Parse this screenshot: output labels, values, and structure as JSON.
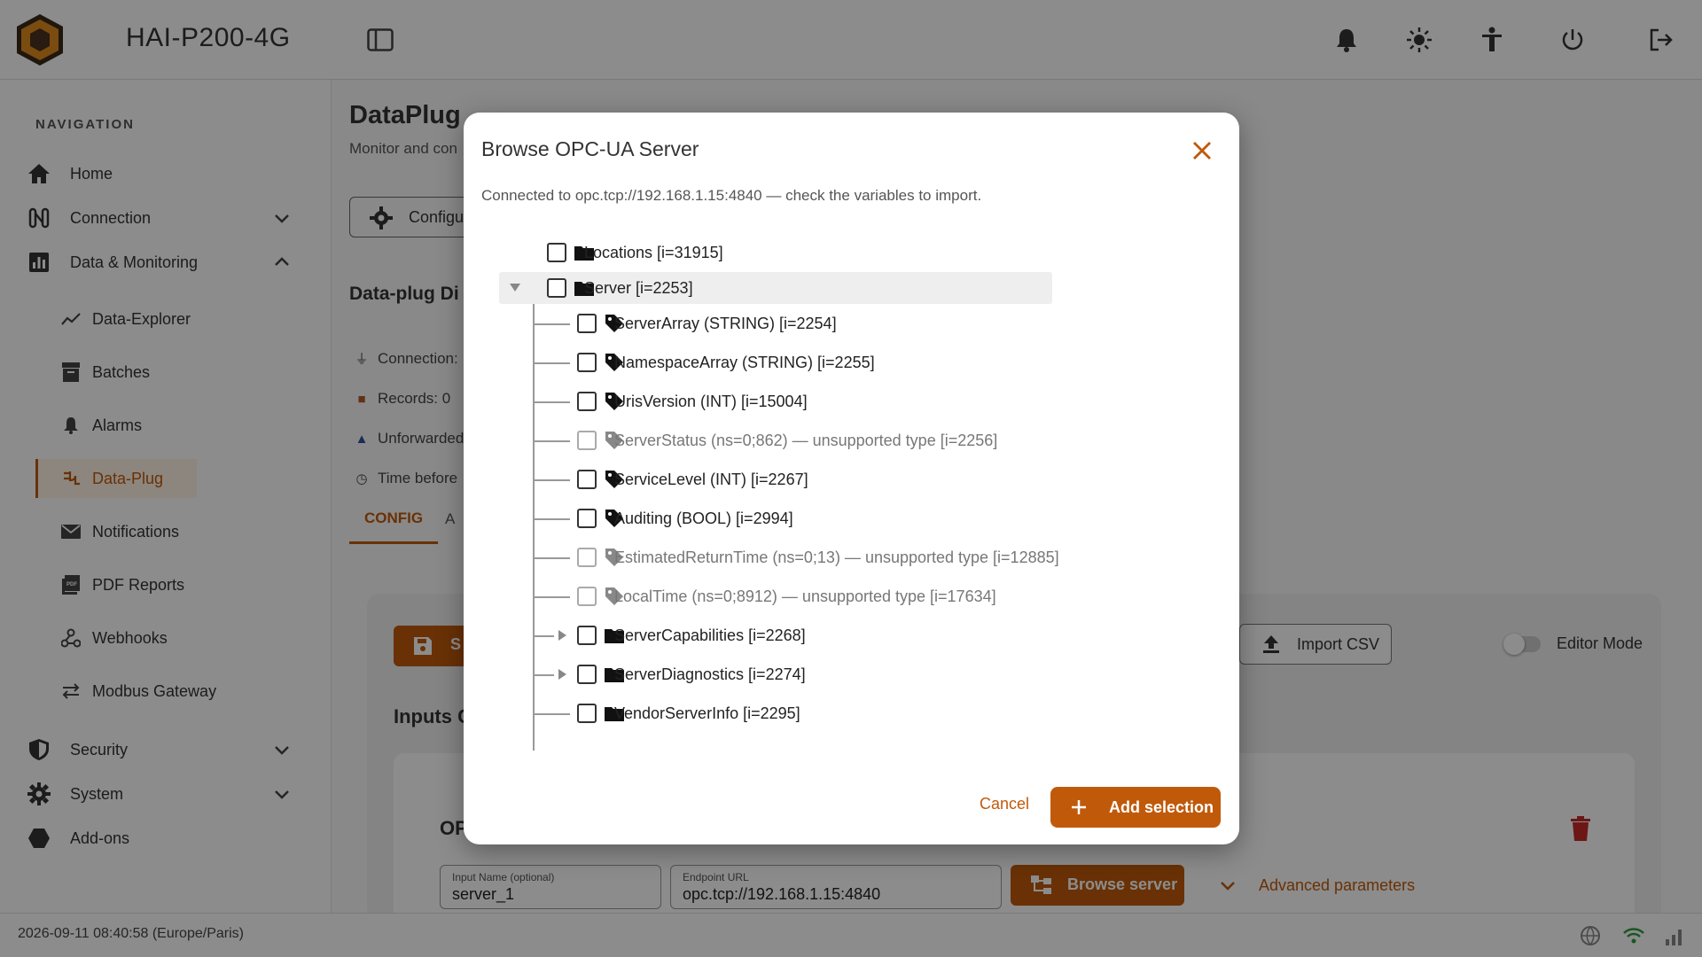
{
  "app": {
    "title": "HAI-P200-4G"
  },
  "sidebar": {
    "heading": "NAVIGATION",
    "items": [
      {
        "label": "Home",
        "icon": "home-icon"
      },
      {
        "label": "Connection",
        "icon": "connection-icon"
      },
      {
        "label": "Data & Monitoring",
        "icon": "chart-icon"
      },
      {
        "label": "Security",
        "icon": "shield-icon"
      },
      {
        "label": "System",
        "icon": "gear-icon"
      },
      {
        "label": "Add-ons",
        "icon": "hexagon-icon"
      }
    ],
    "sub_items": [
      {
        "label": "Data-Explorer"
      },
      {
        "label": "Batches"
      },
      {
        "label": "Alarms"
      },
      {
        "label": "Data-Plug",
        "active": true
      },
      {
        "label": "Notifications"
      },
      {
        "label": "PDF Reports"
      },
      {
        "label": "Webhooks"
      },
      {
        "label": "Modbus Gateway"
      }
    ]
  },
  "main": {
    "title": "DataPlug",
    "subtitle": "Monitor and con",
    "config_button": "Configu",
    "diag_title": "Data-plug Di",
    "diag_lines": [
      "Connection: ",
      "Records: 0",
      "Unforwarded",
      "Time before "
    ],
    "tabs": [
      "CONFIG",
      "A"
    ],
    "save_label": "S",
    "import_csv": "Import CSV",
    "editor_mode": "Editor Mode",
    "inputs_title": "Inputs C",
    "op_label": "OP",
    "input_name_label": "Input Name (optional)",
    "input_name_value": "server_1",
    "endpoint_label": "Endpoint URL",
    "endpoint_value": "opc.tcp://192.168.1.15:4840",
    "browse_server": "Browse server",
    "advanced": "Advanced parameters"
  },
  "footer": {
    "datetime": "2026-09-11 08:40:58 (Europe/Paris)"
  },
  "dialog": {
    "title": "Browse OPC-UA Server",
    "description": "Connected to opc.tcp://192.168.1.15:4840 — check the variables to import.",
    "cancel": "Cancel",
    "add_selection": "Add selection",
    "tree": [
      {
        "label": "Locations [i=31915]",
        "type": "folder",
        "level": 0,
        "expander": "none",
        "disabled": false
      },
      {
        "label": "Server [i=2253]",
        "type": "folder",
        "level": 0,
        "expander": "open",
        "disabled": false,
        "highlight": true
      },
      {
        "label": "ServerArray (STRING) [i=2254]",
        "type": "tag",
        "level": 1,
        "expander": "none",
        "disabled": false
      },
      {
        "label": "NamespaceArray (STRING) [i=2255]",
        "type": "tag",
        "level": 1,
        "expander": "none",
        "disabled": false
      },
      {
        "label": "UrisVersion (INT) [i=15004]",
        "type": "tag",
        "level": 1,
        "expander": "none",
        "disabled": false
      },
      {
        "label": "ServerStatus (ns=0;862) — unsupported type [i=2256]",
        "type": "tag",
        "level": 1,
        "expander": "none",
        "disabled": true
      },
      {
        "label": "ServiceLevel (INT) [i=2267]",
        "type": "tag",
        "level": 1,
        "expander": "none",
        "disabled": false
      },
      {
        "label": "Auditing (BOOL) [i=2994]",
        "type": "tag",
        "level": 1,
        "expander": "none",
        "disabled": false
      },
      {
        "label": "EstimatedReturnTime (ns=0;13) — unsupported type [i=12885]",
        "type": "tag",
        "level": 1,
        "expander": "none",
        "disabled": true
      },
      {
        "label": "LocalTime (ns=0;8912) — unsupported type [i=17634]",
        "type": "tag",
        "level": 1,
        "expander": "none",
        "disabled": true
      },
      {
        "label": "ServerCapabilities [i=2268]",
        "type": "folder",
        "level": 1,
        "expander": "closed",
        "disabled": false
      },
      {
        "label": "ServerDiagnostics [i=2274]",
        "type": "folder",
        "level": 1,
        "expander": "closed",
        "disabled": false
      },
      {
        "label": "VendorServerInfo [i=2295]",
        "type": "folder",
        "level": 1,
        "expander": "none",
        "disabled": false
      }
    ]
  },
  "colors": {
    "accent": "#c05a0a",
    "danger": "#c62828",
    "wifi": "#2e9e3e"
  }
}
